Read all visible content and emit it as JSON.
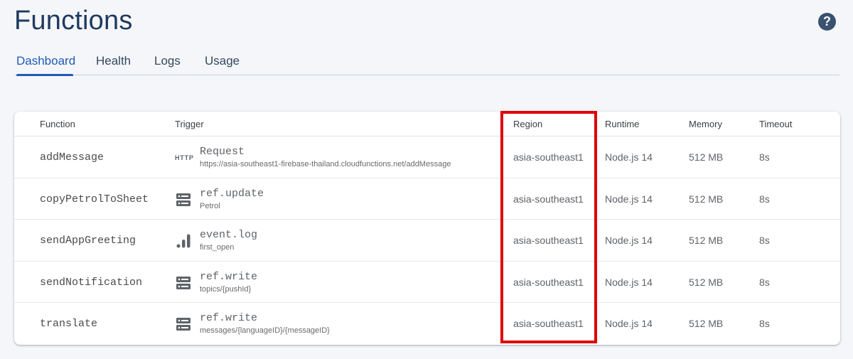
{
  "header": {
    "title": "Functions",
    "help_icon": "help-circle-icon"
  },
  "tabs": [
    {
      "label": "Dashboard",
      "active": true
    },
    {
      "label": "Health",
      "active": false
    },
    {
      "label": "Logs",
      "active": false
    },
    {
      "label": "Usage",
      "active": false
    }
  ],
  "table": {
    "columns": [
      "Function",
      "Trigger",
      "Region",
      "Runtime",
      "Memory",
      "Timeout"
    ],
    "rows": [
      {
        "name": "addMessage",
        "trigger_icon": "http-icon",
        "trigger_badge": "HTTP",
        "trigger_type": "Request",
        "trigger_detail": "https://asia-southeast1-firebase-thailand.cloudfunctions.net/addMessage",
        "region": "asia-southeast1",
        "runtime": "Node.js 14",
        "memory": "512 MB",
        "timeout": "8s"
      },
      {
        "name": "copyPetrolToSheet",
        "trigger_icon": "database-icon",
        "trigger_type": "ref.update",
        "trigger_detail": "Petrol",
        "region": "asia-southeast1",
        "runtime": "Node.js 14",
        "memory": "512 MB",
        "timeout": "8s"
      },
      {
        "name": "sendAppGreeting",
        "trigger_icon": "analytics-icon",
        "trigger_type": "event.log",
        "trigger_detail": "first_open",
        "region": "asia-southeast1",
        "runtime": "Node.js 14",
        "memory": "512 MB",
        "timeout": "8s"
      },
      {
        "name": "sendNotification",
        "trigger_icon": "database-icon",
        "trigger_type": "ref.write",
        "trigger_detail": "topics/{pushId}",
        "region": "asia-southeast1",
        "runtime": "Node.js 14",
        "memory": "512 MB",
        "timeout": "8s"
      },
      {
        "name": "translate",
        "trigger_icon": "database-icon",
        "trigger_type": "ref.write",
        "trigger_detail": "messages/{languageID}/{messageID}",
        "region": "asia-southeast1",
        "runtime": "Node.js 14",
        "memory": "512 MB",
        "timeout": "8s"
      }
    ]
  },
  "colors": {
    "title": "#1f3a5f",
    "accent": "#1f5bb8",
    "highlight": "#e00000"
  }
}
